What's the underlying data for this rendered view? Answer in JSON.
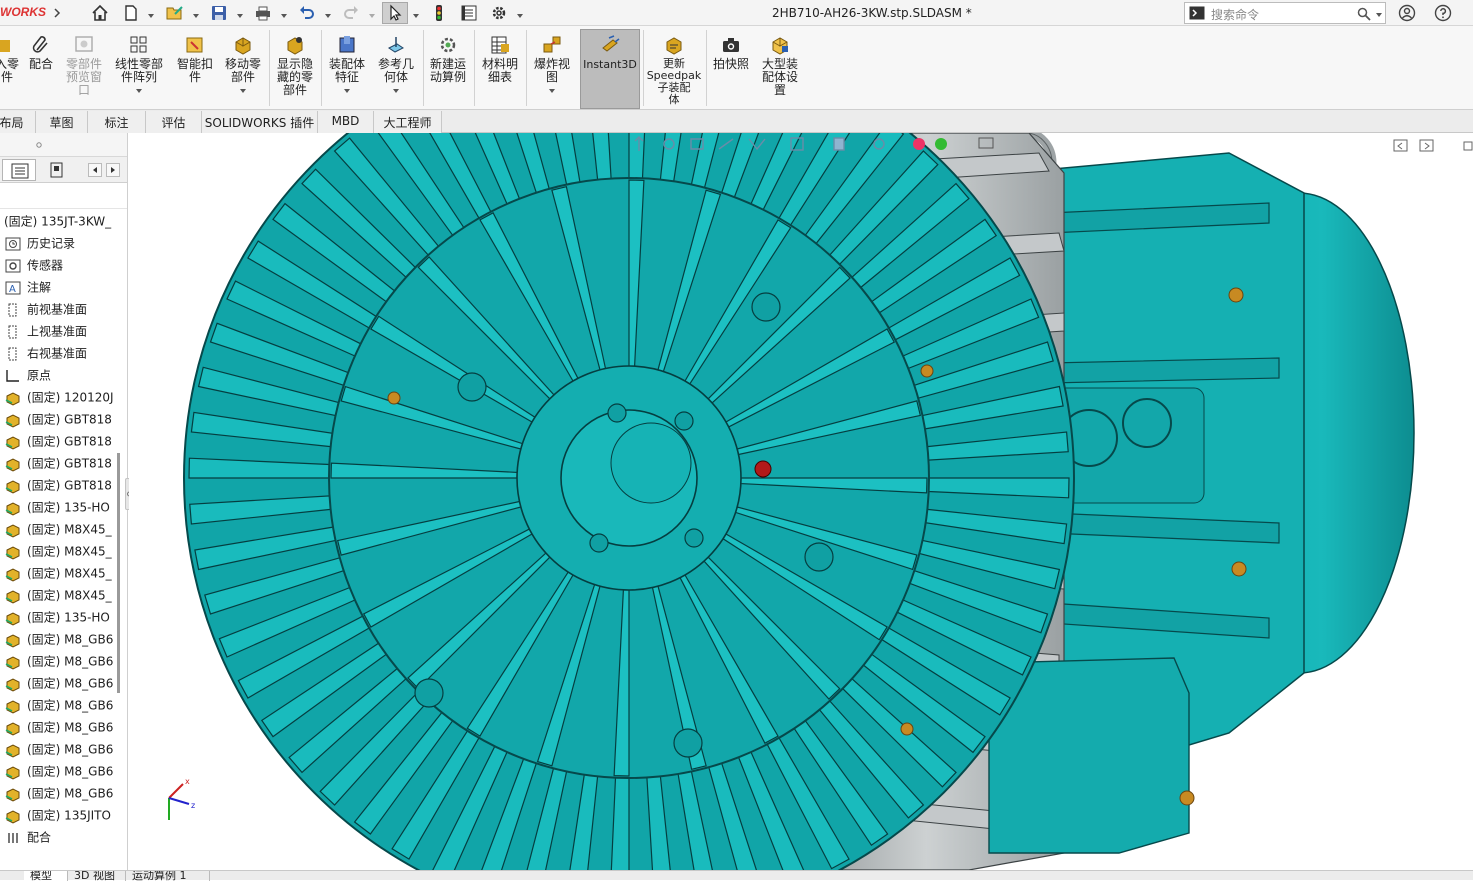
{
  "app": {
    "brand": "WORKS",
    "document_title": "2HB710-AH26-3KW.stp.SLDASM *"
  },
  "search": {
    "placeholder": "搜索命令"
  },
  "ribbon": {
    "buttons": [
      {
        "label": "入零\n件"
      },
      {
        "label": "配合"
      },
      {
        "label": "零部件\n预览窗\n口",
        "disabled": true
      },
      {
        "label": "线性零部\n件阵列"
      },
      {
        "label": "智能扣\n件"
      },
      {
        "label": "移动零\n部件"
      },
      {
        "label": "显示隐\n藏的零\n部件"
      },
      {
        "label": "装配体\n特征"
      },
      {
        "label": "参考几\n何体"
      },
      {
        "label": "新建运\n动算例"
      },
      {
        "label": "材料明\n细表"
      },
      {
        "label": "爆炸视\n图"
      },
      {
        "label": "Instant3D",
        "active": true
      },
      {
        "label": "更新\nSpeedpak\n子装配\n体"
      },
      {
        "label": "拍快照"
      },
      {
        "label": "大型装\n配体设\n置"
      }
    ]
  },
  "tabs": [
    "布局",
    "草图",
    "标注",
    "评估",
    "SOLIDWORKS 插件",
    "MBD",
    "大工程师"
  ],
  "tree": {
    "root": "(固定) 135JT-3KW_",
    "items": [
      {
        "label": "历史记录",
        "icon": "history-icon"
      },
      {
        "label": "传感器",
        "icon": "sensor-icon"
      },
      {
        "label": "注解",
        "icon": "annotation-icon"
      },
      {
        "label": "前视基准面",
        "icon": "plane-icon"
      },
      {
        "label": "上视基准面",
        "icon": "plane-icon"
      },
      {
        "label": "右视基准面",
        "icon": "plane-icon"
      },
      {
        "label": "原点",
        "icon": "origin-icon"
      },
      {
        "label": "(固定) 120120J",
        "icon": "part-icon"
      },
      {
        "label": "(固定) GBT818",
        "icon": "part-icon"
      },
      {
        "label": "(固定) GBT818",
        "icon": "part-icon"
      },
      {
        "label": "(固定) GBT818",
        "icon": "part-icon"
      },
      {
        "label": "(固定) GBT818",
        "icon": "part-icon"
      },
      {
        "label": "(固定) 135-HO",
        "icon": "part-icon"
      },
      {
        "label": "(固定) M8X45_",
        "icon": "part-icon"
      },
      {
        "label": "(固定) M8X45_",
        "icon": "part-icon"
      },
      {
        "label": "(固定) M8X45_",
        "icon": "part-icon"
      },
      {
        "label": "(固定) M8X45_",
        "icon": "part-icon"
      },
      {
        "label": "(固定) 135-HO",
        "icon": "part-icon"
      },
      {
        "label": "(固定) M8_GB6",
        "icon": "part-icon"
      },
      {
        "label": "(固定) M8_GB6",
        "icon": "part-icon"
      },
      {
        "label": "(固定) M8_GB6",
        "icon": "part-icon"
      },
      {
        "label": "(固定) M8_GB6",
        "icon": "part-icon"
      },
      {
        "label": "(固定) M8_GB6",
        "icon": "part-icon"
      },
      {
        "label": "(固定) M8_GB6",
        "icon": "part-icon"
      },
      {
        "label": "(固定) M8_GB6",
        "icon": "part-icon"
      },
      {
        "label": "(固定) M8_GB6",
        "icon": "part-icon"
      },
      {
        "label": "(固定) 135JITO",
        "icon": "part-icon"
      },
      {
        "label": "配合",
        "icon": "mate-icon"
      }
    ]
  },
  "bottom_tabs": [
    "模型",
    "3D 视图",
    "运动算例 1"
  ],
  "colors": {
    "model_teal": "#17b3b5",
    "model_dark": "#0c6d70",
    "grey_fins": "#b8bcbe",
    "brand_red": "#d33333"
  }
}
